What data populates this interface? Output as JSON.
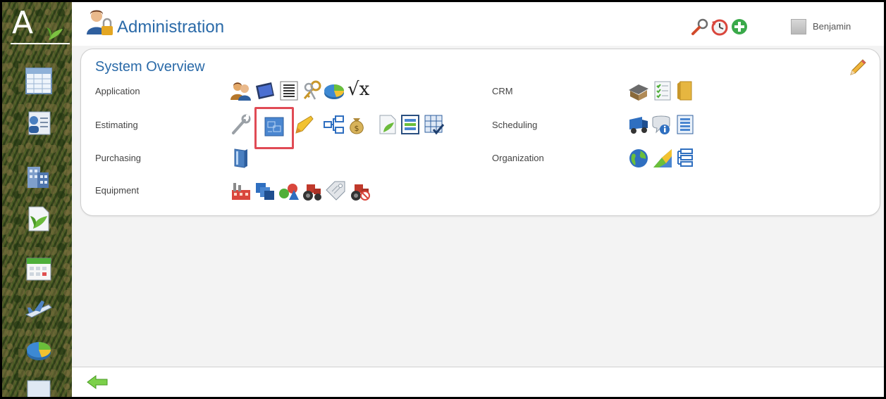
{
  "logo": {
    "letter": "A"
  },
  "header": {
    "title": "Administration",
    "user_name": "Benjamin"
  },
  "panel": {
    "title": "System Overview",
    "sections_left": [
      {
        "label": "Application",
        "icons": [
          "users-icon",
          "tablet-icon",
          "list-icon",
          "keys-icon",
          "pie-chart-icon",
          "sqrt-x-icon"
        ]
      },
      {
        "label": "Estimating",
        "icons": [
          "wrench-icon",
          "blueprint-icon",
          "pencil-arrow-icon",
          "hierarchy-icon",
          "money-bag-icon",
          "plant-document-icon",
          "report-icon",
          "checklist-grid-icon"
        ]
      },
      {
        "label": "Purchasing",
        "icons": [
          "book-icon"
        ]
      },
      {
        "label": "Equipment",
        "icons": [
          "factory-icon",
          "stack-icon",
          "shapes-icon",
          "tractor-icon",
          "tag-icon",
          "tractor-no-icon"
        ]
      }
    ],
    "sections_right": [
      {
        "label": "CRM",
        "icons": [
          "house-icon",
          "document-check-icon",
          "folder-icon"
        ]
      },
      {
        "label": "Scheduling",
        "icons": [
          "truck-icon",
          "chat-info-icon",
          "list-doc-icon"
        ]
      },
      {
        "label": "Organization",
        "icons": [
          "globe-icon",
          "map-icon",
          "org-list-icon"
        ]
      }
    ],
    "sqrt_text": "√x"
  },
  "colors": {
    "accent": "#2a6aa8",
    "highlight": "#e04b55"
  }
}
